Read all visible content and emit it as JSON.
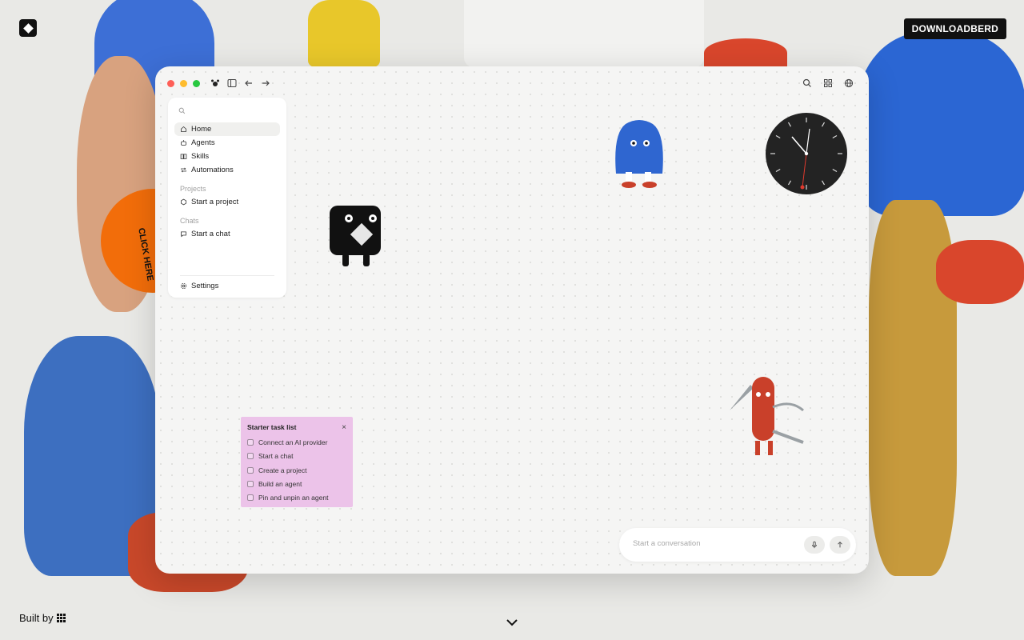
{
  "header": {
    "download_label": "DOWNLOADBERD"
  },
  "badge": {
    "click_here_label": "CLICK HERE"
  },
  "footer": {
    "built_by_label": "Built by"
  },
  "sidebar": {
    "search_icon": "search-icon",
    "nav": [
      {
        "label": "Home",
        "icon": "home-icon",
        "active": true
      },
      {
        "label": "Agents",
        "icon": "robot-icon"
      },
      {
        "label": "Skills",
        "icon": "book-icon"
      },
      {
        "label": "Automations",
        "icon": "repeat-icon"
      }
    ],
    "projects_heading": "Projects",
    "start_project_label": "Start a project",
    "chats_heading": "Chats",
    "start_chat_label": "Start a chat",
    "settings_label": "Settings"
  },
  "tasks": {
    "title": "Starter task list",
    "close": "×",
    "items": [
      "Connect an AI provider",
      "Start a chat",
      "Create a project",
      "Build an agent",
      "Pin and unpin an agent"
    ]
  },
  "composer": {
    "placeholder": "Start a conversation"
  },
  "colors": {
    "accent_orange": "#f26d0a",
    "task_card": "#ecc3e9",
    "traffic_red": "#fe5f57",
    "traffic_yellow": "#febc2e",
    "traffic_green": "#28c840"
  }
}
